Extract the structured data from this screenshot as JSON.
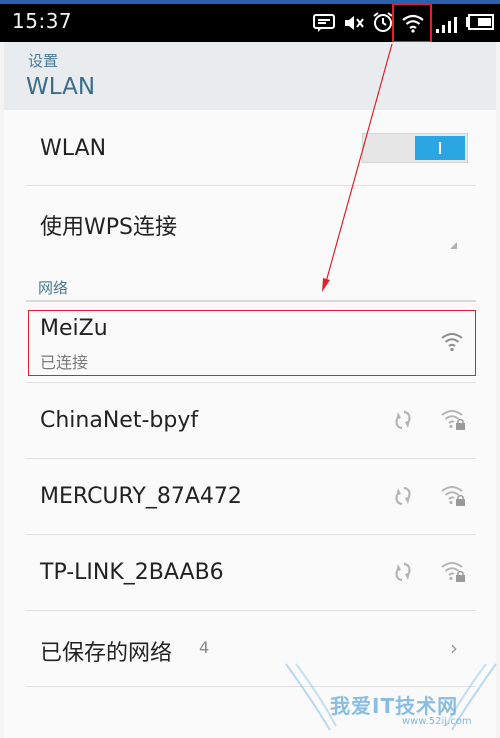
{
  "status_bar": {
    "time": "15:37",
    "icons": [
      "message-icon",
      "mute-icon",
      "alarm-icon",
      "wifi-icon",
      "signal-icon",
      "battery-icon"
    ]
  },
  "header": {
    "parent": "设置",
    "title": "WLAN"
  },
  "wlan_toggle": {
    "label": "WLAN",
    "state": "on"
  },
  "wps": {
    "label": "使用WPS连接"
  },
  "networks_section": {
    "label": "网络"
  },
  "networks": [
    {
      "ssid": "MeiZu",
      "status": "已连接",
      "secured": false,
      "icon": "wifi-icon"
    },
    {
      "ssid": "ChinaNet-bpyf",
      "secured": true,
      "icon": "wifi-lock-icon"
    },
    {
      "ssid": "MERCURY_87A472",
      "secured": true,
      "icon": "wifi-lock-icon"
    },
    {
      "ssid": "TP-LINK_2BAAB6",
      "secured": true,
      "icon": "wifi-lock-icon"
    }
  ],
  "saved_networks": {
    "label": "已保存的网络",
    "count": "4"
  },
  "watermark": {
    "text": "我爱IT技术网",
    "url": "www.52ij.com"
  },
  "colors": {
    "accent": "#2aa7e3",
    "annotation": "#e0202a",
    "header_text": "#3b6d8a"
  }
}
